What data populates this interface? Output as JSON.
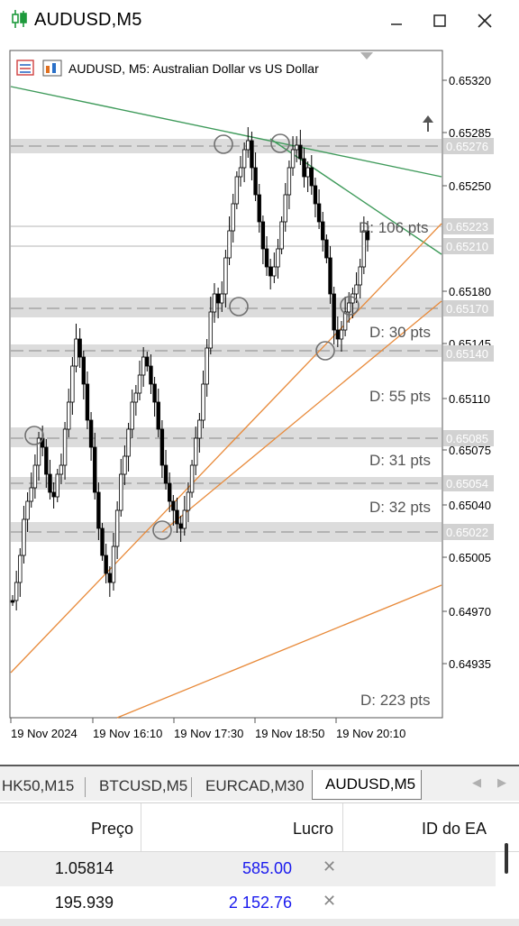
{
  "window": {
    "title": "AUDUSD,M5"
  },
  "chart": {
    "header": "AUDUSD, M5:  Australian Dollar vs US Dollar",
    "price_scale": [
      "0.65320",
      "0.65285",
      "0.65250",
      "0.65180",
      "0.65145",
      "0.65110",
      "0.65075",
      "0.65040",
      "0.65005",
      "0.64970",
      "0.64935"
    ],
    "level_labels": [
      "0.65276",
      "0.65223",
      "0.65210",
      "0.65170",
      "0.65140",
      "0.65085",
      "0.65054",
      "0.65022"
    ],
    "distance_labels": [
      "D: 106 pts",
      "D: 30 pts",
      "D: 55 pts",
      "D: 31 pts",
      "D: 32 pts",
      "D: 223 pts"
    ],
    "time_scale": [
      "19 Nov 2024",
      "19 Nov 16:10",
      "19 Nov 17:30",
      "19 Nov 18:50",
      "19 Nov 20:10"
    ]
  },
  "tabs": [
    {
      "label": "HK50,M15",
      "active": false
    },
    {
      "label": "BTCUSD,M5",
      "active": false
    },
    {
      "label": "EURCAD,M30",
      "active": false
    },
    {
      "label": "AUDUSD,M5",
      "active": true
    }
  ],
  "table": {
    "columns": [
      "Preço",
      "Lucro",
      "ID do EA"
    ],
    "rows": [
      {
        "price": "1.05814",
        "profit": "585.00"
      },
      {
        "price": "195.939",
        "profit": "2 152.76"
      }
    ]
  },
  "colors": {
    "accent_green": "#1e9a3c",
    "trend_green": "#3e9a5a",
    "trend_orange": "#e88a3a",
    "profit_blue": "#1a1aee",
    "level_band": "#d9d9d9"
  }
}
